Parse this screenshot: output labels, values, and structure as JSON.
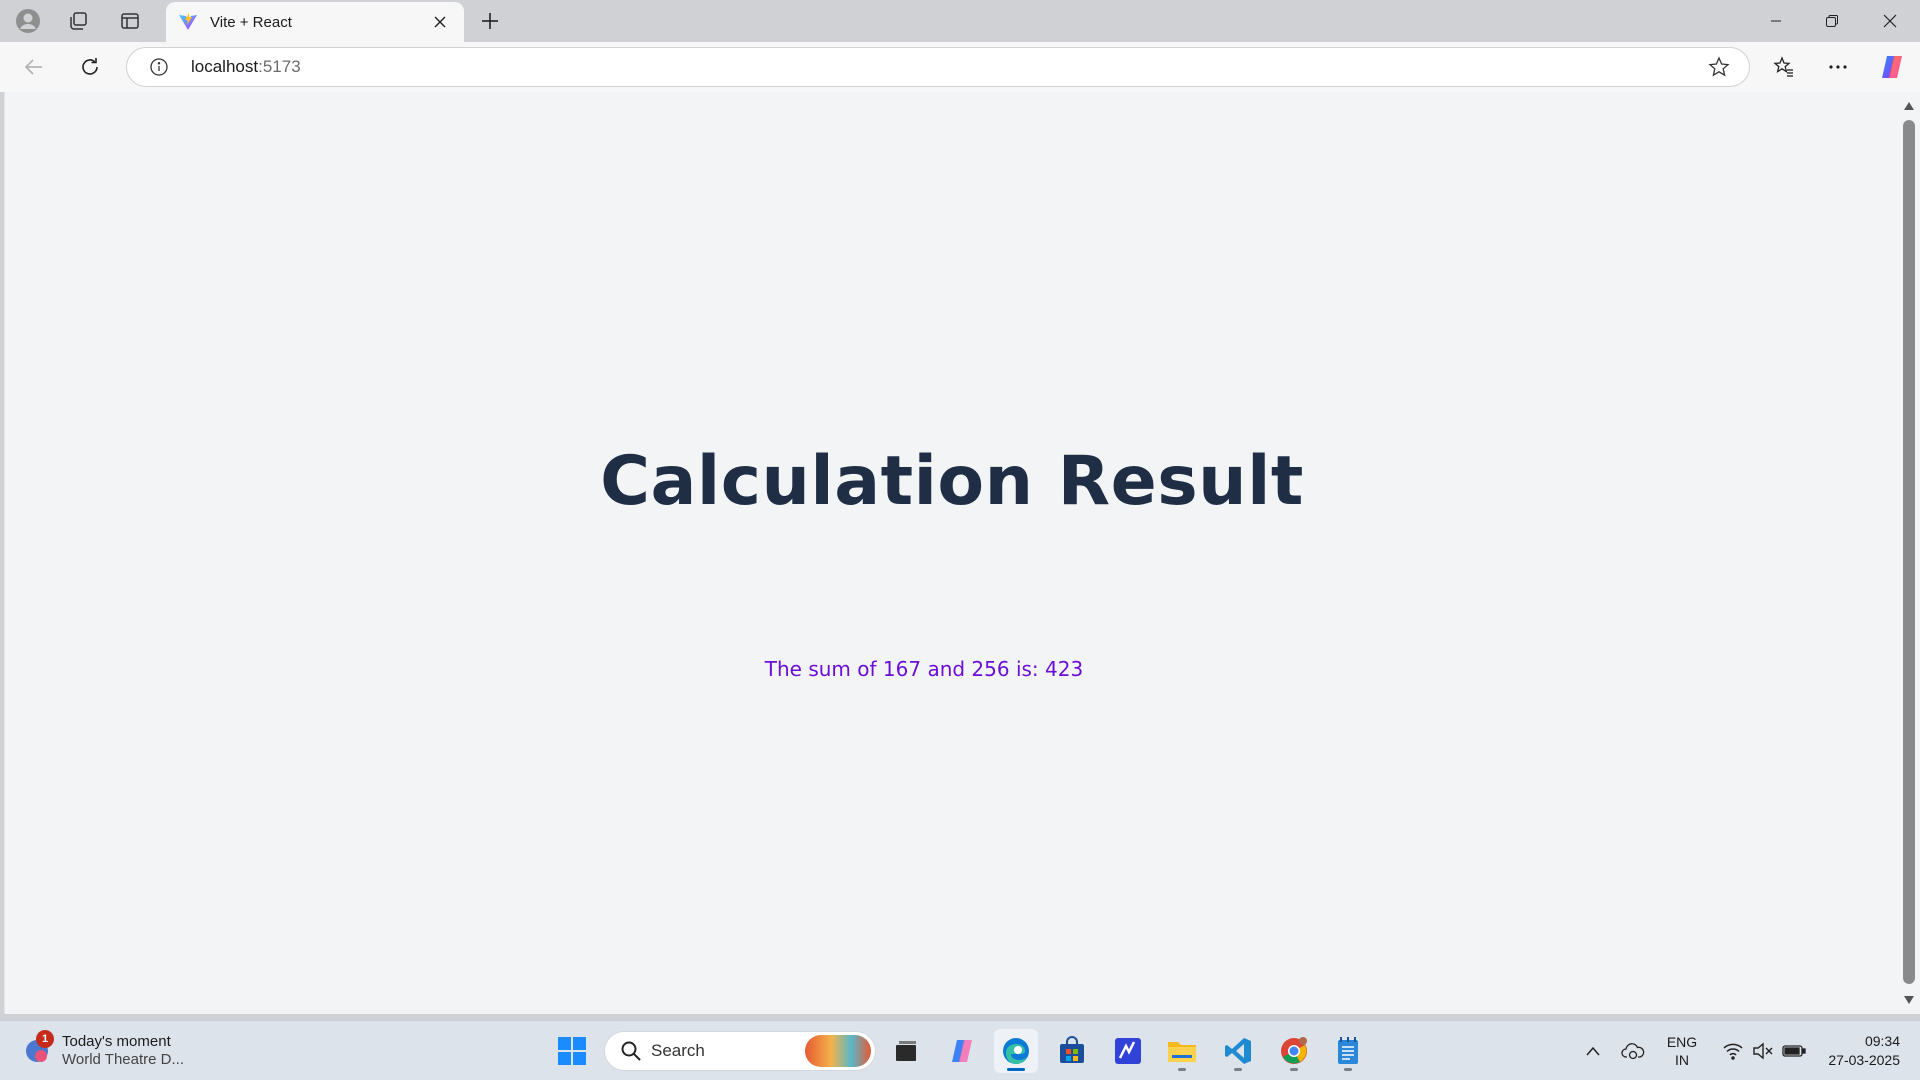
{
  "browser": {
    "tab": {
      "title": "Vite + React"
    },
    "address": {
      "host": "localhost",
      "port": ":5173"
    }
  },
  "page": {
    "title": "Calculation Result",
    "result_text": "The sum of 167 and 256 is: 423"
  },
  "taskbar": {
    "widget": {
      "badge": "1",
      "title": "Today's moment",
      "subtitle": "World Theatre D..."
    },
    "search": {
      "label": "Search"
    },
    "tray": {
      "lang_line1": "ENG",
      "lang_line2": "IN",
      "time": "09:34",
      "date": "27-03-2025"
    }
  },
  "colors": {
    "heading": "#1f2d45",
    "result": "#6b0ed8",
    "page_background": "#f3f4f6",
    "accent": "#0067c0"
  }
}
